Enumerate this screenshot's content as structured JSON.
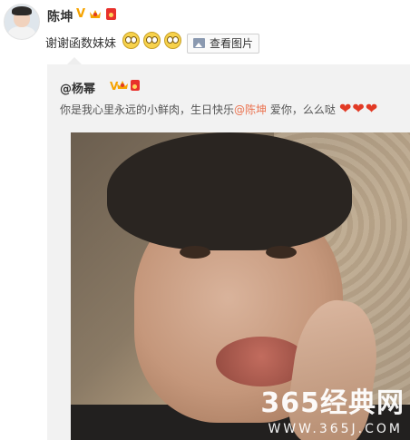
{
  "post": {
    "author": "陈坤",
    "text": "谢谢函数妹妹",
    "view_image_label": "查看图片"
  },
  "repost": {
    "author": "@杨幂",
    "text_before": "你是我心里永远的小鲜肉，生日快乐",
    "mention": "@陈坤",
    "text_after": " 爱你，么么哒"
  },
  "icons": {
    "verified": "verified-v-icon",
    "crown": "vip-crown-icon",
    "red_envelope": "red-envelope-icon",
    "emoji": "sleepy-emoji-icon",
    "heart": "heart-icon",
    "image": "image-icon"
  },
  "watermark": {
    "title": "365经典网",
    "url": "WWW.365J.COM"
  },
  "colors": {
    "mention": "#eb7350",
    "heart": "#e23a25",
    "verified": "#f6a300"
  }
}
